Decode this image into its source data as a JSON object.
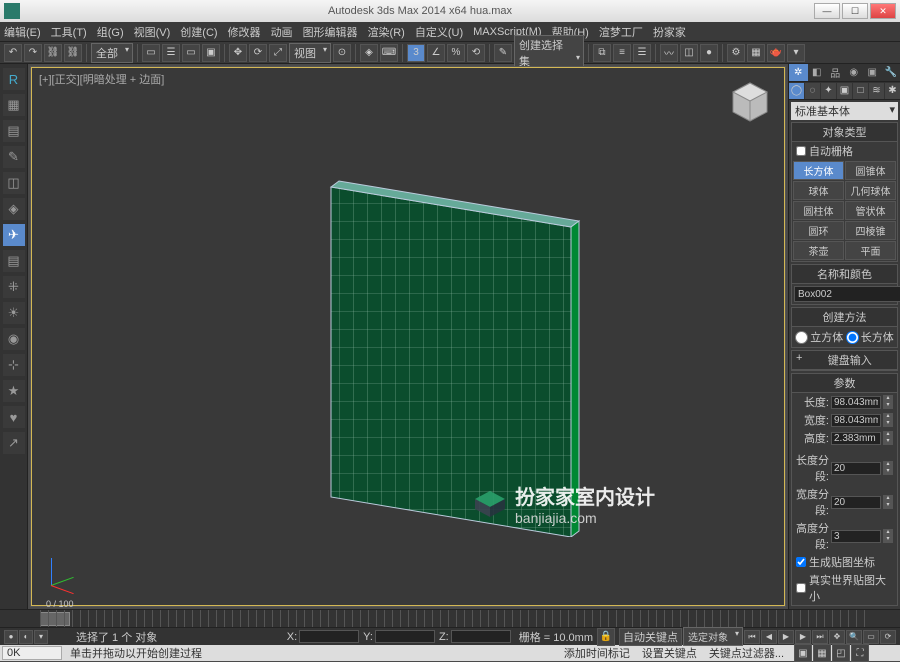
{
  "title": "Autodesk 3ds Max  2014 x64    hua.max",
  "menu": [
    "编辑(E)",
    "工具(T)",
    "组(G)",
    "视图(V)",
    "创建(C)",
    "修改器",
    "动画",
    "图形编辑器",
    "渲染(R)",
    "自定义(U)",
    "MAXScript(M)",
    "帮助(H)",
    "渲梦工厂",
    "扮家家"
  ],
  "toolbar1": {
    "dd": "全部",
    "ribbon_dd": "视图",
    "selectset": "创建选择集"
  },
  "viewport": {
    "label": "[+][正交][明暗处理 + 边面]"
  },
  "timeline": {
    "range": "0 / 100"
  },
  "rightpanel": {
    "category_dd": "标准基本体",
    "sec_objtype": "对象类型",
    "auto_grid": "自动栅格",
    "prims": [
      "长方体",
      "圆锥体",
      "球体",
      "几何球体",
      "圆柱体",
      "管状体",
      "圆环",
      "四棱锥",
      "茶壶",
      "平面"
    ],
    "sec_name": "名称和颜色",
    "obj_name": "Box002",
    "sec_method": "创建方法",
    "radio_cube": "立方体",
    "radio_box": "长方体",
    "sec_keyboard": "键盘输入",
    "sec_params": "参数",
    "p_length": "长度:",
    "v_length": "98.043mm",
    "p_width": "宽度:",
    "v_width": "98.043mm",
    "p_height": "高度:",
    "v_height": "2.383mm",
    "p_lseg": "长度分段:",
    "v_lseg": "20",
    "p_wseg": "宽度分段:",
    "v_wseg": "20",
    "p_hseg": "高度分段:",
    "v_hseg": "3",
    "chk_mapcoords": "生成贴图坐标",
    "chk_realworld": "真实世界贴图大小"
  },
  "status": {
    "sel": "选择了 1 个 对象",
    "x": "X:",
    "xv": "",
    "y": "Y:",
    "yv": "",
    "z": "Z:",
    "zv": "",
    "grid": "栅格 = 10.0mm",
    "autokey": "自动关键点",
    "seldd": "选定对象",
    "hint": "单击并拖动以开始创建过程",
    "timetag": "添加时间标记",
    "setkey": "设置关键点",
    "keyfilter": "关键点过滤器...",
    "ok": "0K"
  },
  "watermark": {
    "line1": "扮家家室内设计",
    "line2": "banjiajia.com"
  }
}
